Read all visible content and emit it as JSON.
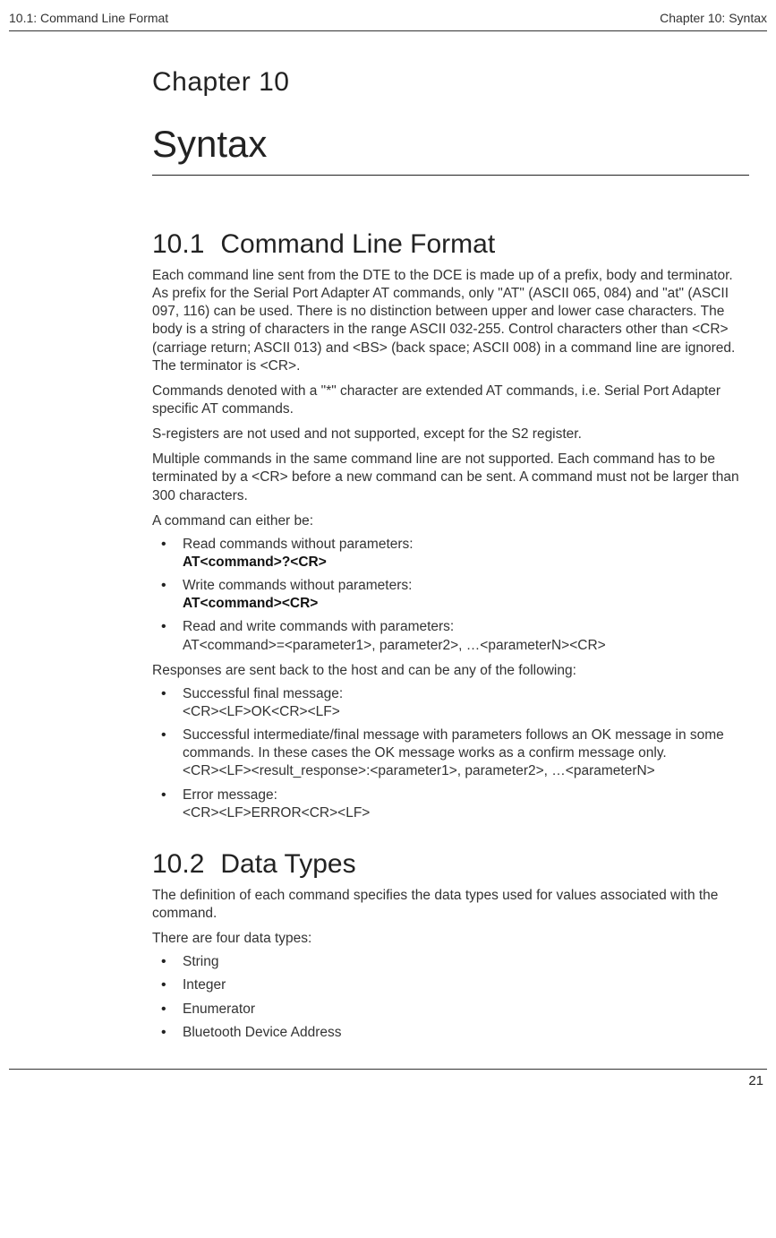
{
  "header": {
    "left": "10.1: Command Line Format",
    "right": "Chapter 10: Syntax"
  },
  "chapter": {
    "label": "Chapter 10",
    "title": "Syntax"
  },
  "section1": {
    "num": "10.1",
    "title": "Command Line Format",
    "p1": "Each command line sent from the DTE to the DCE is made up of a prefix, body and terminator. As prefix for the Serial Port Adapter AT commands, only \"AT\" (ASCII 065, 084) and \"at\" (ASCII 097, 116) can be used. There is no distinction between upper and lower case characters. The body is a string of characters in the range ASCII 032-255. Control characters other than <CR> (carriage return; ASCII 013) and <BS> (back space; ASCII 008) in a command line are ignored. The terminator is <CR>.",
    "p2": "Commands denoted with a \"*\" character are extended AT commands, i.e. Serial Port Adapter specific AT commands.",
    "p3": "S-registers are not used and not supported, except for the S2 register.",
    "p4": "Multiple commands in the same command line are not supported. Each command has to be terminated by a <CR> before a new command can be sent. A command must not be larger than 300 characters.",
    "p5": "A command can either be:",
    "list1": {
      "i1a": "Read commands without parameters:",
      "i1b": "AT<command>?<CR>",
      "i2a": "Write commands without parameters:",
      "i2b": "AT<command><CR>",
      "i3a": "Read and write commands with parameters:",
      "i3b": "AT<command>=<parameter1>, parameter2>, …<parameterN><CR>"
    },
    "p6": "Responses are sent back to the host and can be any of the following:",
    "list2": {
      "i1a": "Successful final message:",
      "i1b": "<CR><LF>OK<CR><LF>",
      "i2a": "Successful intermediate/final message with parameters follows an OK message in some commands. In these cases the OK message works as a confirm message only.",
      "i2b": "<CR><LF><result_response>:<parameter1>, parameter2>,  …<parameterN>",
      "i3a": "Error message:",
      "i3b": "<CR><LF>ERROR<CR><LF>"
    }
  },
  "section2": {
    "num": "10.2",
    "title": "Data Types",
    "p1": "The definition of each command specifies the data types used for values associated with the command.",
    "p2": "There are four data types:",
    "list": {
      "i1": "String",
      "i2": "Integer",
      "i3": "Enumerator",
      "i4": "Bluetooth Device Address"
    }
  },
  "footer": {
    "pagenum": "21"
  }
}
